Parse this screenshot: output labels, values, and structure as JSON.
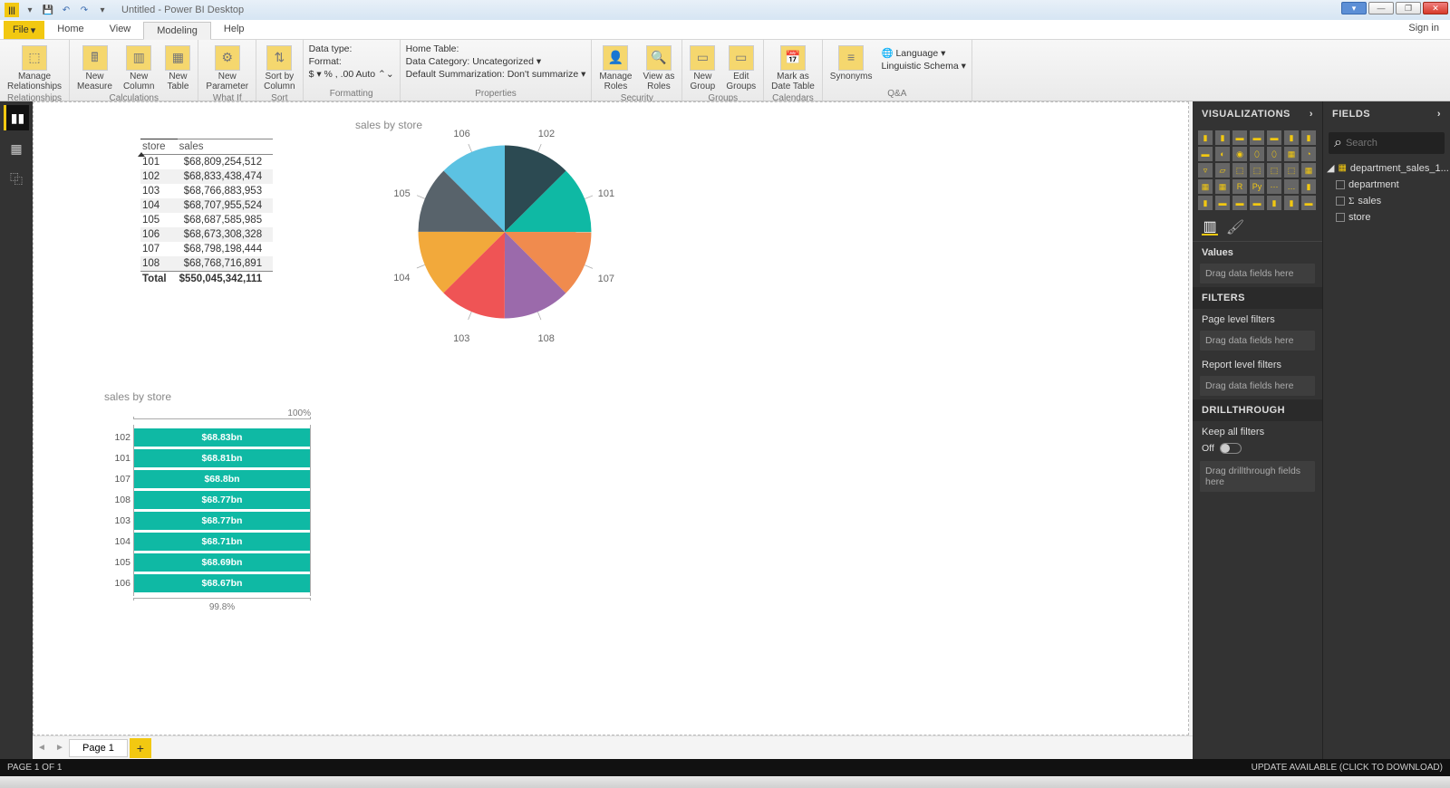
{
  "title": "Untitled - Power BI Desktop",
  "signin": "Sign in",
  "tabs": {
    "file": "File",
    "home": "Home",
    "view": "View",
    "modeling": "Modeling",
    "help": "Help"
  },
  "ribbon": {
    "relationships": {
      "btn": "Manage\nRelationships",
      "lbl": "Relationships"
    },
    "calculations": {
      "measure": "New\nMeasure",
      "column": "New\nColumn",
      "table": "New\nTable",
      "lbl": "Calculations"
    },
    "whatif": {
      "btn": "New\nParameter",
      "lbl": "What If"
    },
    "sort": {
      "btn": "Sort by\nColumn",
      "lbl": "Sort"
    },
    "formatting": {
      "datatype": "Data type: ",
      "format": "Format: ",
      "sym": "$ ▾ %  ,  .00  Auto ⌃⌄",
      "lbl": "Formatting"
    },
    "properties": {
      "hometable": "Home Table: ",
      "datcat": "Data Category: Uncategorized ▾",
      "summ": "Default Summarization: Don't summarize ▾",
      "lbl": "Properties"
    },
    "security": {
      "manage": "Manage\nRoles",
      "view": "View as\nRoles",
      "lbl": "Security"
    },
    "groups": {
      "new": "New\nGroup",
      "edit": "Edit\nGroups",
      "lbl": "Groups"
    },
    "calendars": {
      "btn": "Mark as\nDate Table",
      "lbl": "Calendars"
    },
    "qna": {
      "syn": "Synonyms",
      "lang": "Language ▾",
      "ling": "Linguistic Schema ▾",
      "lbl": "Q&A"
    }
  },
  "page_tab": "Page 1",
  "status_left": "PAGE 1 OF 1",
  "status_right": "UPDATE AVAILABLE (CLICK TO DOWNLOAD)",
  "viz_pane": {
    "title": "VISUALIZATIONS",
    "values": "Values",
    "drag": "Drag data fields here",
    "filters": "FILTERS",
    "pagef": "Page level filters",
    "reportf": "Report level filters",
    "drill": "DRILLTHROUGH",
    "keep": "Keep all filters",
    "off": "Off",
    "dragdrill": "Drag drillthrough fields here"
  },
  "fields_pane": {
    "title": "FIELDS",
    "search": "Search",
    "table": "department_sales_1...",
    "fields": [
      "department",
      "sales",
      "store"
    ]
  },
  "chart_data": [
    {
      "type": "table",
      "title": "sales by store",
      "columns": [
        "store",
        "sales"
      ],
      "rows": [
        [
          "101",
          "$68,809,254,512"
        ],
        [
          "102",
          "$68,833,438,474"
        ],
        [
          "103",
          "$68,766,883,953"
        ],
        [
          "104",
          "$68,707,955,524"
        ],
        [
          "105",
          "$68,687,585,985"
        ],
        [
          "106",
          "$68,673,308,328"
        ],
        [
          "107",
          "$68,798,198,444"
        ],
        [
          "108",
          "$68,768,716,891"
        ]
      ],
      "total": [
        "Total",
        "$550,045,342,111"
      ]
    },
    {
      "type": "pie",
      "title": "sales by store",
      "categories": [
        "101",
        "102",
        "103",
        "104",
        "105",
        "106",
        "107",
        "108"
      ],
      "values": [
        68809254512,
        68833438474,
        68766883953,
        68707955524,
        68687585985,
        68673308328,
        68798198444,
        68768716891
      ],
      "colors": [
        "#0fb9a4",
        "#2c4a52",
        "#ef5455",
        "#f2a93b",
        "#58636b",
        "#5cc2e2",
        "#f08b4e",
        "#9b6aab"
      ]
    },
    {
      "type": "bar",
      "title": "sales by store",
      "orientation": "horizontal",
      "xmax_label": "100%",
      "xmin_label": "99.8%",
      "categories": [
        "102",
        "101",
        "107",
        "108",
        "103",
        "104",
        "105",
        "106"
      ],
      "value_labels": [
        "$68.83bn",
        "$68.81bn",
        "$68.8bn",
        "$68.77bn",
        "$68.77bn",
        "$68.71bn",
        "$68.69bn",
        "$68.67bn"
      ],
      "rel_widths": [
        1.0,
        0.9997,
        0.9995,
        0.9991,
        0.999,
        0.9982,
        0.9979,
        0.9977
      ]
    }
  ]
}
